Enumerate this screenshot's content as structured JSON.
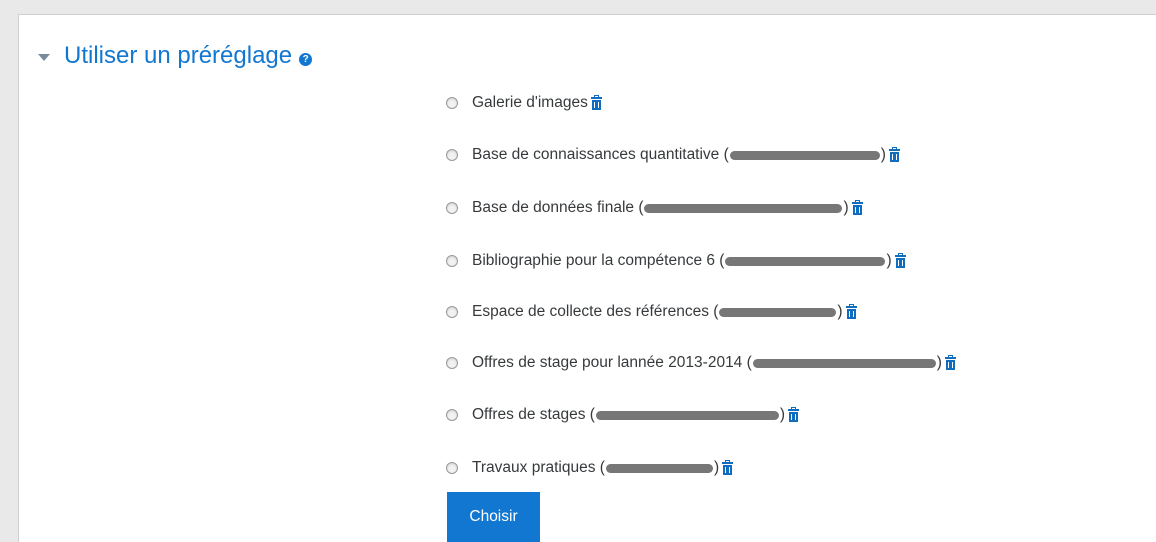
{
  "section": {
    "title": "Utiliser un préréglage",
    "help_icon_glyph": "?"
  },
  "presets": [
    {
      "label": "Galerie d'images",
      "suffix": ""
    },
    {
      "label": "Base de connaissances quantitative (",
      "suffix": ")"
    },
    {
      "label": "Base de données finale (",
      "suffix": ")"
    },
    {
      "label": "Bibliographie pour la compétence 6 (",
      "suffix": ")"
    },
    {
      "label": "Espace de collecte des références (",
      "suffix": ")"
    },
    {
      "label": "Offres de stage pour lannée 2013-2014 (",
      "suffix": ")"
    },
    {
      "label": "Offres de stages (",
      "suffix": ")"
    },
    {
      "label": "Travaux pratiques (",
      "suffix": ")"
    }
  ],
  "choose_button": "Choisir",
  "colors": {
    "accent": "#1177d1",
    "text": "#373a3c"
  },
  "icons": {
    "collapse": "caret-down-icon",
    "help": "question-circle-icon",
    "delete": "trash-icon"
  }
}
